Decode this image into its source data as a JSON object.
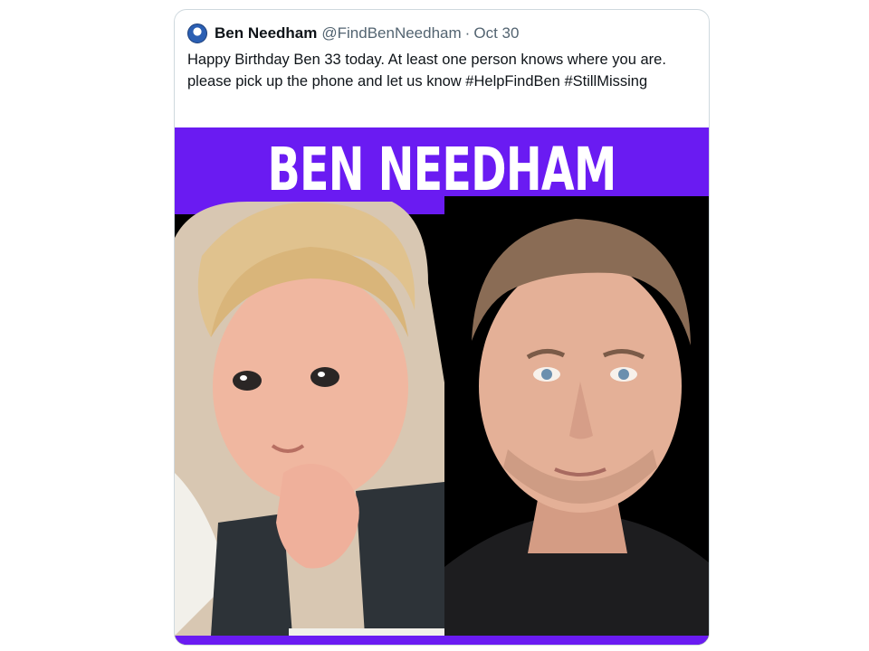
{
  "tweet": {
    "display_name": "Ben Needham",
    "handle": "@FindBenNeedham",
    "separator": "·",
    "date": "Oct 30",
    "text": "Happy Birthday Ben 33 today. At least one person knows where you are. please pick up the phone and let us know #HelpFindBen #StillMissing"
  },
  "media": {
    "title": "BEN NEEDHAM",
    "accent_color": "#6a1bf2"
  }
}
